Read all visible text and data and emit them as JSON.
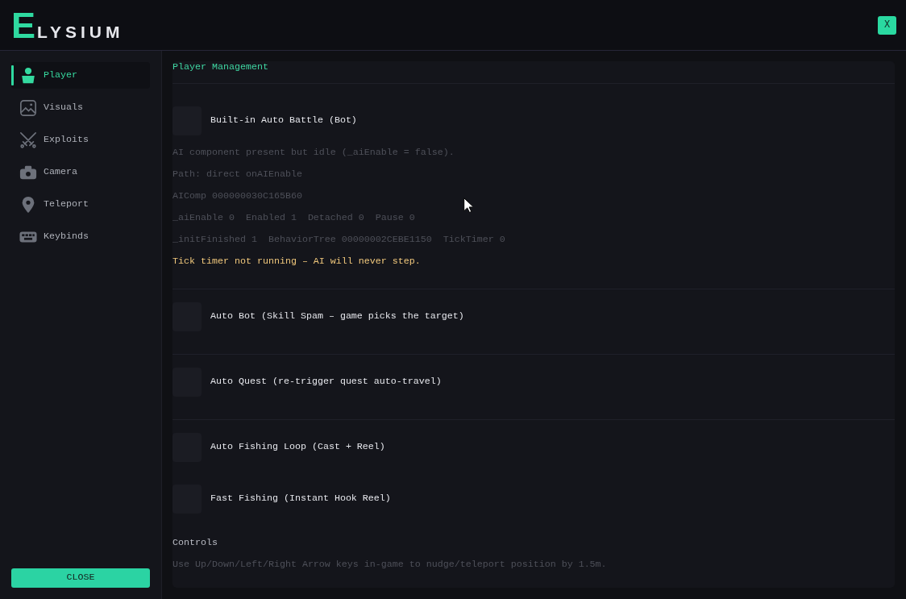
{
  "brand": "ELYSIUM",
  "close_button": "X",
  "sidebar": {
    "items": [
      {
        "label": "Player",
        "selected": true
      },
      {
        "label": "Visuals",
        "selected": false
      },
      {
        "label": "Exploits",
        "selected": false
      },
      {
        "label": "Camera",
        "selected": false
      },
      {
        "label": "Teleport",
        "selected": false
      },
      {
        "label": "Keybinds",
        "selected": false
      }
    ],
    "close_button": "CLOSE"
  },
  "panel": {
    "title": "Player Management",
    "groups": [
      {
        "toggles": [
          {
            "label": "Built-in Auto Battle (Bot)",
            "checked": false,
            "details": [
              {
                "text": "AI component present but idle (_aiEnable = false).",
                "kind": "info"
              },
              {
                "text": "Path: direct onAIEnable",
                "kind": "info"
              },
              {
                "text": "AIComp 000000030C165B60",
                "kind": "info"
              },
              {
                "text": "_aiEnable 0  Enabled 1  Detached 0  Pause 0",
                "kind": "info"
              },
              {
                "text": "_initFinished 1  BehaviorTree 00000002CEBE1150  TickTimer 0",
                "kind": "info"
              },
              {
                "text": "Tick timer not running – AI will never step.",
                "kind": "warning"
              }
            ]
          }
        ]
      },
      {
        "toggles": [
          {
            "label": "Auto Bot (Skill Spam – game picks the target)",
            "checked": false
          }
        ]
      },
      {
        "toggles": [
          {
            "label": "Auto Quest (re-trigger quest auto-travel)",
            "checked": false
          }
        ]
      },
      {
        "toggles": [
          {
            "label": "Auto Fishing Loop (Cast + Reel)",
            "checked": false
          },
          {
            "label": "Fast Fishing (Instant Hook Reel)",
            "checked": false
          }
        ]
      }
    ],
    "controls": {
      "title": "Controls",
      "hint": "Use Up/Down/Left/Right Arrow keys in-game to nudge/teleport position by 1.5m."
    }
  }
}
